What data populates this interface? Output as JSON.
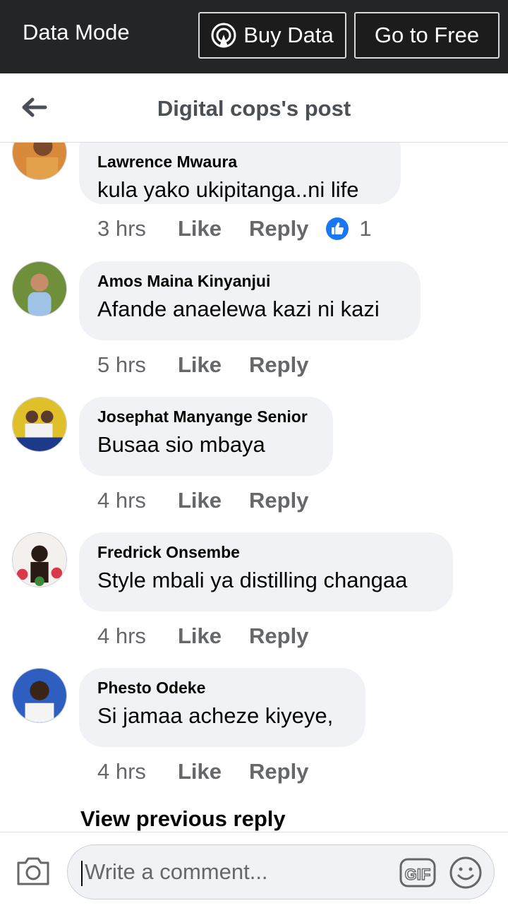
{
  "topbar": {
    "mode_label": "Data Mode",
    "buy_label": "Buy Data",
    "free_label": "Go to Free"
  },
  "header": {
    "title": "Digital cops's post"
  },
  "comments": [
    {
      "name": "Lawrence Mwaura",
      "text": "kula yako ukipitanga..ni life",
      "time": "3 hrs",
      "like": "Like",
      "reply": "Reply",
      "reaction_count": "1"
    },
    {
      "name": "Amos Maina Kinyanjui",
      "text": "Afande anaelewa kazi ni kazi",
      "time": "5 hrs",
      "like": "Like",
      "reply": "Reply"
    },
    {
      "name": "Josephat Manyange Senior",
      "text": "Busaa sio mbaya",
      "time": "4 hrs",
      "like": "Like",
      "reply": "Reply"
    },
    {
      "name": "Fredrick Onsembe",
      "text": "Style mbali ya distilling changaa",
      "time": "4 hrs",
      "like": "Like",
      "reply": "Reply"
    },
    {
      "name": "Phesto Odeke",
      "text": "Si jamaa acheze kiyeye,",
      "time": "4 hrs",
      "like": "Like",
      "reply": "Reply"
    }
  ],
  "view_previous": "View previous reply",
  "composer": {
    "placeholder": "Write a comment..."
  },
  "icons": {
    "back": "arrow-left-icon",
    "buy": "broadcast-icon",
    "reaction": "thumbs-up-icon",
    "camera": "camera-icon",
    "gif": "gif-icon",
    "emoji": "smiley-icon"
  },
  "colors": {
    "topbar": "#242526",
    "bubble": "#f0f2f5",
    "like_blue": "#1877f2"
  }
}
